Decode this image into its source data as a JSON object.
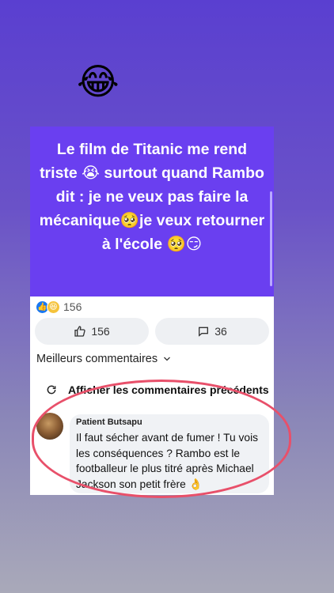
{
  "story": {
    "emoji": "😂"
  },
  "post": {
    "text": "Le film de Titanic me rend triste 😭 surtout quand Rambo dit : je ne veux pas faire la mécanique🥺je veux retourner à l'école 🥺😏"
  },
  "reactions": {
    "like_icon": "👍",
    "haha_icon": "😆",
    "count": "156"
  },
  "actions": {
    "like_count": "156",
    "comment_count": "36"
  },
  "comments": {
    "sort_label": "Meilleurs commentaires",
    "previous_label": "Afficher les commentaires précédents",
    "items": [
      {
        "author": "Patient Butsapu",
        "text": "Il faut sécher avant de fumer ! Tu vois les conséquences ? Rambo est le footballeur le plus titré après Michael Jackson son petit frère 👌"
      }
    ]
  },
  "colors": {
    "post_bg": "#6a3ff0",
    "annotation": "#e8506a",
    "like_blue": "#1877f2"
  }
}
